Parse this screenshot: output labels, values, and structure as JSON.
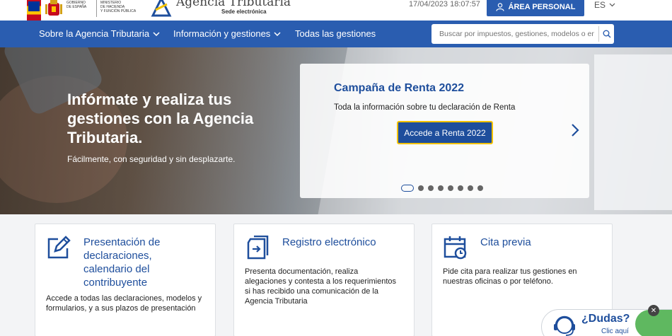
{
  "header": {
    "gov_lines": [
      "GOBIERNO",
      "DE ESPAÑA"
    ],
    "ministry_lines": [
      "MINISTERIO",
      "DE HACIENDA",
      "Y FUNCIÓN PÚBLICA"
    ],
    "agency_name": "Agencia Tributaria",
    "agency_sub": "Sede electrónica",
    "datetime": "17/04/2023 18:07:57",
    "personal_area": "ÁREA PERSONAL",
    "language": "ES"
  },
  "nav": {
    "items": [
      {
        "label": "Sobre la Agencia Tributaria",
        "dropdown": true
      },
      {
        "label": "Información y gestiones",
        "dropdown": true
      },
      {
        "label": "Todas las gestiones",
        "dropdown": false
      }
    ],
    "search_placeholder": "Buscar por impuestos, gestiones, modelos o en ..."
  },
  "hero": {
    "title": "Infórmate y realiza tus gestiones con la Agencia Tributaria.",
    "subtitle": "Fácilmente, con seguridad y sin desplazarte.",
    "promo": {
      "title": "Campaña de Renta 2022",
      "text": "Toda la información sobre tu declaración de Renta",
      "button": "Accede a Renta 2022"
    },
    "slides_count": 8,
    "active_slide": 1
  },
  "cards": [
    {
      "title": "Presentación de declaraciones, calendario del contribuyente",
      "text": "Accede a todas las declaraciones, modelos y formularios, y a sus plazos de presentación",
      "icon": "edit-document-icon"
    },
    {
      "title": "Registro electrónico",
      "text": "Presenta documentación, realiza alegaciones y contesta a los requerimientos si has recibido una comunicación de la Agencia Tributaria",
      "icon": "file-import-icon"
    },
    {
      "title": "Cita previa",
      "text": "Pide cita para realizar tus gestiones en nuestras oficinas o por teléfono.",
      "icon": "calendar-clock-icon"
    }
  ],
  "help": {
    "title": "¿Dudas?",
    "subtitle": "Clic aquí"
  },
  "colors": {
    "primary": "#2a5db0",
    "link": "#1e4e9c",
    "accent": "#f3c200"
  }
}
